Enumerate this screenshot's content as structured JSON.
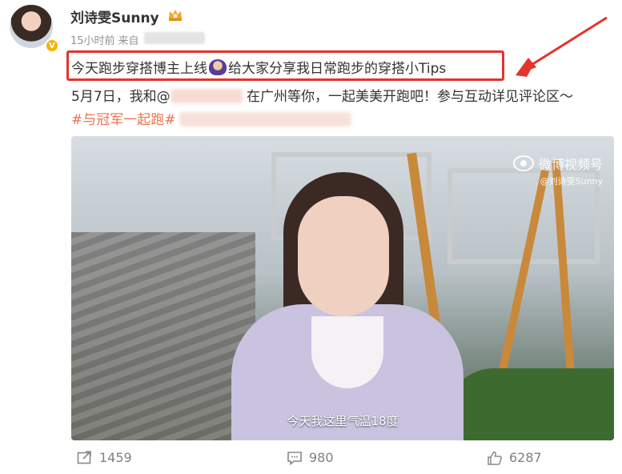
{
  "post": {
    "username": "刘诗雯Sunny",
    "time": "15小时前",
    "source_prefix": "来自",
    "line1_a": "今天跑步穿搭博主上线",
    "line1_b": "给大家分享我日常跑步的穿搭小Tips",
    "line2_a": "5月7日，我和@",
    "line2_b": "在广州等你，一起美美开跑吧！参与互动详见评论区～",
    "hashtag": "#与冠军一起跑#"
  },
  "video": {
    "watermark_title": "微博视频号",
    "watermark_handle": "@刘诗雯Sunny",
    "subtitle": "今天我这里气温18度"
  },
  "actions": {
    "repost_count": "1459",
    "comment_count": "980",
    "like_count": "6287"
  },
  "colors": {
    "highlight_box": "#e4332b",
    "hashtag": "#eb7350",
    "verified": "#f4b400"
  },
  "icons": [
    "crown-icon",
    "verified-icon",
    "repost-icon",
    "comment-icon",
    "like-icon",
    "weibo-eye-icon"
  ]
}
